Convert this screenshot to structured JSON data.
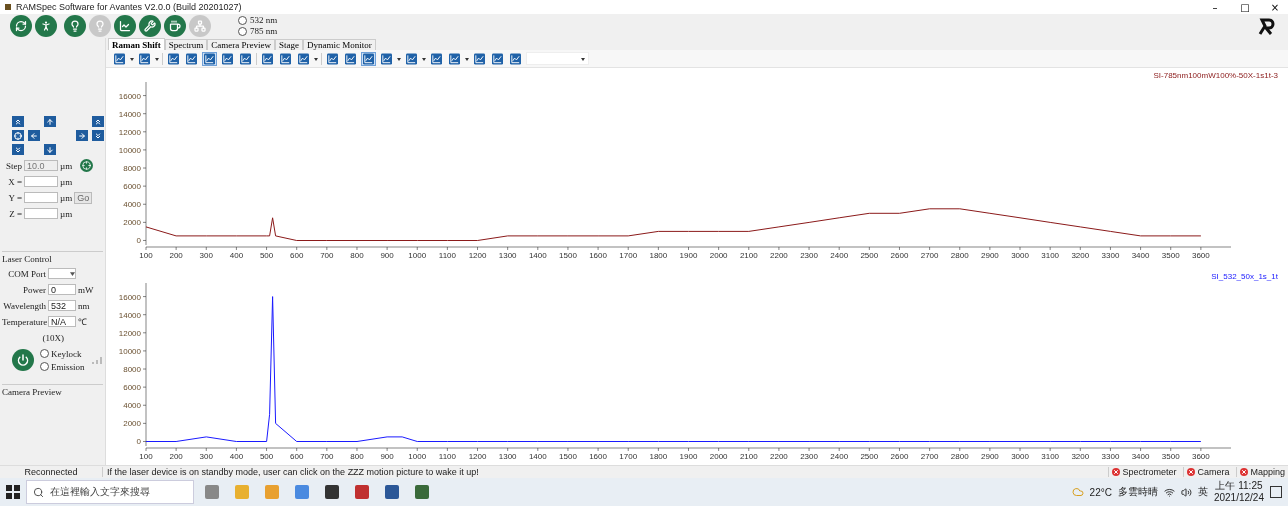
{
  "window": {
    "title": "RAMSpec Software for Avantes V2.0.0 (Build 20201027)",
    "controls": [
      "–",
      "□",
      "×"
    ]
  },
  "main_buttons": [
    {
      "disabled": false
    },
    {
      "disabled": false
    },
    {
      "disabled": false
    },
    {
      "disabled": true
    },
    {
      "disabled": false
    },
    {
      "disabled": false
    },
    {
      "disabled": false
    },
    {
      "disabled": true
    }
  ],
  "wavelength_options": [
    {
      "label": "532 nm",
      "selected": false
    },
    {
      "label": "785 nm",
      "selected": false
    }
  ],
  "tabs": [
    {
      "label": "Raman Shift",
      "selected": true
    },
    {
      "label": "Spectrum",
      "selected": false
    },
    {
      "label": "Camera Preview",
      "selected": false
    },
    {
      "label": "Stage",
      "selected": false
    },
    {
      "label": "Dynamic Monitor",
      "selected": false
    }
  ],
  "toolbar": [
    {
      "kind": "button",
      "selected": false
    },
    {
      "kind": "dropdown"
    },
    {
      "kind": "button",
      "selected": false
    },
    {
      "kind": "dropdown"
    },
    {
      "kind": "separator"
    },
    {
      "kind": "button",
      "selected": false
    },
    {
      "kind": "button",
      "selected": false
    },
    {
      "kind": "button",
      "selected": true
    },
    {
      "kind": "button",
      "selected": false
    },
    {
      "kind": "button",
      "selected": false
    },
    {
      "kind": "separator"
    },
    {
      "kind": "button",
      "selected": false
    },
    {
      "kind": "button",
      "selected": false
    },
    {
      "kind": "button",
      "selected": false
    },
    {
      "kind": "dropdown"
    },
    {
      "kind": "separator"
    },
    {
      "kind": "button",
      "selected": false
    },
    {
      "kind": "button",
      "selected": false
    },
    {
      "kind": "button",
      "selected": true
    },
    {
      "kind": "button",
      "selected": false
    },
    {
      "kind": "dropdown"
    },
    {
      "kind": "button",
      "selected": false
    },
    {
      "kind": "dropdown"
    },
    {
      "kind": "button",
      "selected": false
    },
    {
      "kind": "button",
      "selected": false
    },
    {
      "kind": "dropdown"
    },
    {
      "kind": "button",
      "selected": false
    },
    {
      "kind": "button",
      "selected": false
    },
    {
      "kind": "button",
      "selected": false
    }
  ],
  "stage": {
    "step": {
      "label": "Step",
      "value": "10.0",
      "unit": "µm",
      "disabled": true
    },
    "axes": [
      {
        "label": "X =",
        "unit": "µm"
      },
      {
        "label": "Y =",
        "unit": "µm"
      },
      {
        "label": "Z =",
        "unit": "µm"
      }
    ],
    "go": {
      "label": "Go",
      "disabled": true
    }
  },
  "laser_control": {
    "title": "Laser Control",
    "com_port": {
      "label": "COM Port"
    },
    "power": {
      "label": "Power",
      "value": "0",
      "unit": "mW"
    },
    "wavelength": {
      "label": "Wavelength",
      "value": "532",
      "unit": "nm"
    },
    "temperature": {
      "label": "Temperature",
      "value": "N/A",
      "unit": "℃",
      "note": "(10X)"
    },
    "indicators": [
      {
        "label": "Keylock",
        "on": false
      },
      {
        "label": "Emission",
        "on": false
      }
    ]
  },
  "camera_preview": {
    "title": "Camera Preview"
  },
  "charts": [
    {
      "chart_data": {
        "type": "line",
        "x": [
          100,
          200,
          300,
          400,
          500,
          510,
          520,
          530,
          600,
          700,
          800,
          900,
          1000,
          1100,
          1200,
          1300,
          1400,
          1500,
          1600,
          1700,
          1800,
          1900,
          2000,
          2100,
          2200,
          2300,
          2400,
          2500,
          2600,
          2700,
          2800,
          2900,
          3000,
          3100,
          3200,
          3300,
          3400,
          3500,
          3600
        ],
        "series": [
          {
            "name": "SI-785nm100mW100%-50X-1s1t-3",
            "color": "#8b1a1a",
            "values": [
              1500,
              500,
              500,
              500,
              500,
              500,
              2500,
              500,
              0,
              0,
              0,
              0,
              0,
              0,
              0,
              500,
              500,
              500,
              500,
              500,
              1000,
              1000,
              1000,
              1000,
              1500,
              2000,
              2500,
              3000,
              3000,
              3500,
              3500,
              3000,
              2500,
              2000,
              1500,
              1000,
              500,
              500,
              500
            ]
          }
        ],
        "xlim": [
          100,
          3700
        ],
        "ylim": [
          -500,
          17500
        ],
        "xticks": [
          100,
          200,
          300,
          400,
          500,
          600,
          700,
          800,
          900,
          1000,
          1100,
          1200,
          1300,
          1400,
          1500,
          1600,
          1700,
          1800,
          1900,
          2000,
          2100,
          2200,
          2300,
          2400,
          2500,
          2600,
          2700,
          2800,
          2900,
          3000,
          3100,
          3200,
          3300,
          3400,
          3500,
          3600
        ],
        "yticks": [
          0,
          2000,
          4000,
          6000,
          8000,
          10000,
          12000,
          14000,
          16000
        ]
      }
    },
    {
      "chart_data": {
        "type": "line",
        "x": [
          100,
          200,
          300,
          400,
          500,
          510,
          520,
          530,
          600,
          700,
          800,
          900,
          950,
          1000,
          1100,
          1200,
          1300,
          1400,
          1500,
          1600,
          1700,
          1800,
          1900,
          2000,
          2100,
          2200,
          2300,
          2400,
          2500,
          2600,
          2700,
          2800,
          2900,
          3000,
          3100,
          3200,
          3300,
          3400,
          3500,
          3600
        ],
        "series": [
          {
            "name": "SI_532_50x_1s_1t",
            "color": "#1a1aff",
            "values": [
              0,
              0,
              500,
              0,
              0,
              3000,
              16000,
              2000,
              0,
              0,
              0,
              500,
              500,
              0,
              0,
              0,
              0,
              0,
              0,
              0,
              0,
              0,
              0,
              0,
              0,
              0,
              0,
              0,
              0,
              0,
              0,
              0,
              0,
              0,
              0,
              0,
              0,
              0,
              0,
              0
            ]
          }
        ],
        "xlim": [
          100,
          3700
        ],
        "ylim": [
          -500,
          17500
        ],
        "xticks": [
          100,
          200,
          300,
          400,
          500,
          600,
          700,
          800,
          900,
          1000,
          1100,
          1200,
          1300,
          1400,
          1500,
          1600,
          1700,
          1800,
          1900,
          2000,
          2100,
          2200,
          2300,
          2400,
          2500,
          2600,
          2700,
          2800,
          2900,
          3000,
          3100,
          3200,
          3300,
          3400,
          3500,
          3600
        ],
        "yticks": [
          0,
          2000,
          4000,
          6000,
          8000,
          10000,
          12000,
          14000,
          16000
        ]
      }
    }
  ],
  "status_bar": {
    "connection": "Reconnected",
    "message": "If the laser device is on standby mode, user can click on the ZZZ motion picture to wake it up!",
    "devices": [
      {
        "label": "Spectrometer",
        "ok": false
      },
      {
        "label": "Camera",
        "ok": false
      },
      {
        "label": "Mapping",
        "ok": false
      }
    ]
  },
  "taskbar": {
    "search": {
      "placeholder": "在這裡輸入文字來搜尋"
    },
    "temperature": "22°C",
    "weather": "多雲時晴",
    "language": "英",
    "time": "上午 11:25",
    "date": "2021/12/24"
  }
}
